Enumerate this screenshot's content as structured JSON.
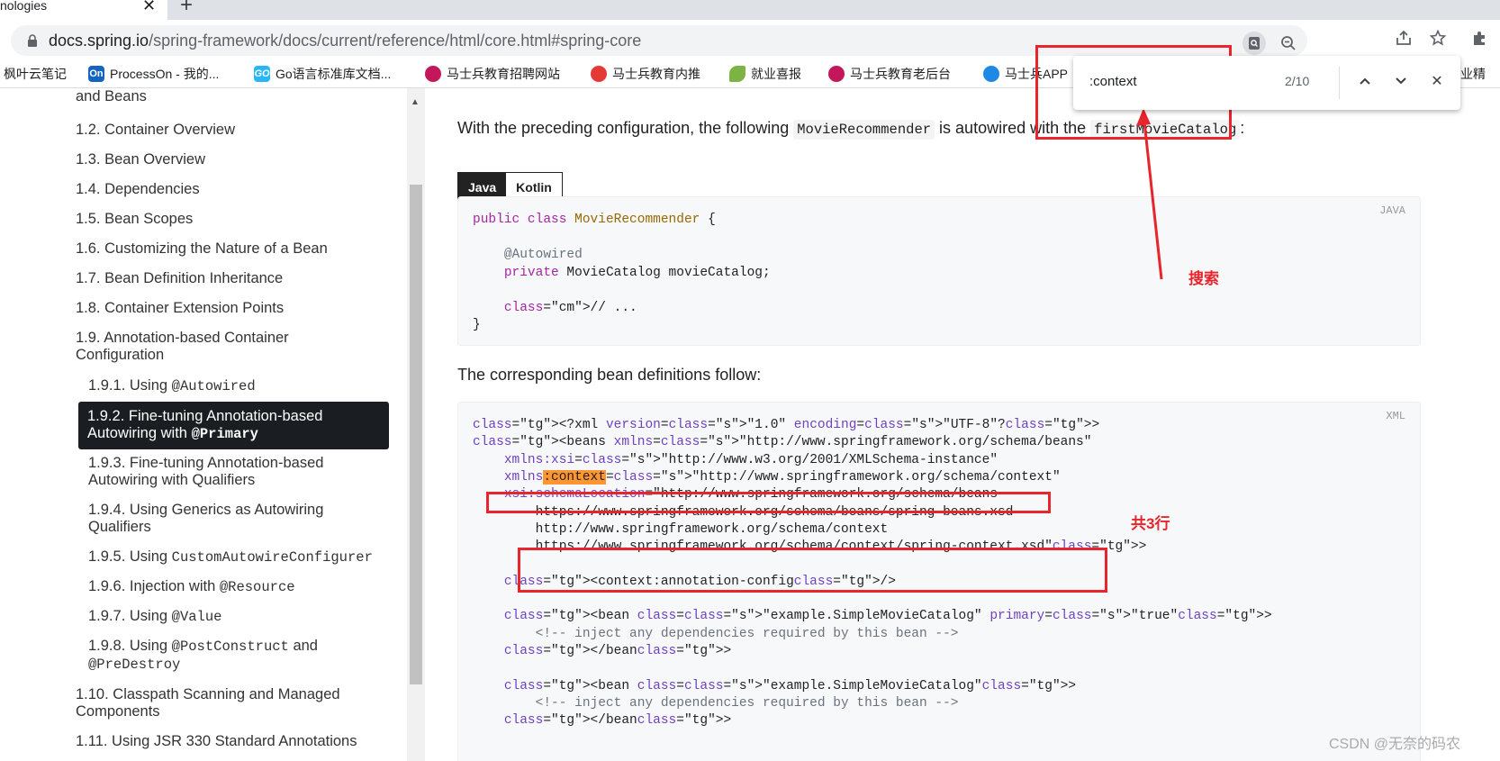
{
  "tab": {
    "title": "nologies",
    "close": "✕",
    "newtab": "+"
  },
  "address": {
    "host": "docs.spring.io",
    "path": "/spring-framework/docs/current/reference/html/core.html#spring-core"
  },
  "toolbar_icons": [
    "find-in-page-icon",
    "zoom-icon",
    "share-icon",
    "bookmark-star-icon",
    "extensions-icon"
  ],
  "bookmarks": [
    {
      "label": "枫叶云笔记",
      "icon_text": "",
      "color": "#4caf50"
    },
    {
      "label": "ProcessOn - 我的...",
      "icon_text": "On",
      "color": "#1565c0"
    },
    {
      "label": "Go语言标准库文档...",
      "icon_text": "GO",
      "color": "#29b6f6"
    },
    {
      "label": "马士兵教育招聘网站",
      "icon_text": "",
      "color": "#c2185b"
    },
    {
      "label": "马士兵教育内推",
      "icon_text": "",
      "color": "#e53935"
    },
    {
      "label": "就业喜报",
      "icon_text": "",
      "color": "#7cb342"
    },
    {
      "label": "马士兵教育老后台",
      "icon_text": "",
      "color": "#c2185b"
    },
    {
      "label": "马士兵APP",
      "icon_text": "",
      "color": "#1e88e5"
    },
    {
      "label": "专业精",
      "icon_text": "",
      "color": "#1e88e5"
    }
  ],
  "find": {
    "query": ":context",
    "count": "2/10",
    "prev": "︿",
    "next": "﹀",
    "close": "✕"
  },
  "toc": [
    {
      "label": "and Beans"
    },
    {
      "label": "1.2. Container Overview"
    },
    {
      "label": "1.3. Bean Overview"
    },
    {
      "label": "1.4. Dependencies"
    },
    {
      "label": "1.5. Bean Scopes"
    },
    {
      "label": "1.6. Customizing the Nature of a Bean"
    },
    {
      "label": "1.7. Bean Definition Inheritance"
    },
    {
      "label": "1.8. Container Extension Points"
    },
    {
      "label": "1.9. Annotation-based Container"
    },
    {
      "label": "Configuration"
    },
    {
      "label": "1.9.1. Using ",
      "code": "@Autowired"
    },
    {
      "label": "1.9.2. Fine-tuning Annotation-based",
      "label2": "Autowiring with ",
      "code": "@Primary"
    },
    {
      "label": "1.9.3. Fine-tuning Annotation-based"
    },
    {
      "label": "Autowiring with Qualifiers"
    },
    {
      "label": "1.9.4. Using Generics as Autowiring"
    },
    {
      "label": "Qualifiers"
    },
    {
      "label": "1.9.5. Using ",
      "code": "CustomAutowireConfigurer"
    },
    {
      "label": "1.9.6. Injection with ",
      "code": "@Resource"
    },
    {
      "label": "1.9.7. Using ",
      "code": "@Value"
    },
    {
      "label": "1.9.8. Using ",
      "code": "@PostConstruct",
      "tail": " and"
    },
    {
      "code": "@PreDestroy"
    },
    {
      "label": "1.10. Classpath Scanning and Managed"
    },
    {
      "label": "Components"
    },
    {
      "label": "1.11. Using JSR 330 Standard Annotations"
    }
  ],
  "main": {
    "p1_a": "With the preceding configuration, the following ",
    "p1_code1": "MovieRecommender",
    "p1_b": " is autowired with the ",
    "p1_code2": "firstMovieCatalog",
    "p1_c": ":",
    "tab_java": "Java",
    "tab_kotlin": "Kotlin",
    "code1_lang": "JAVA",
    "p2": "The corresponding bean definitions follow:",
    "code2_lang": "XML"
  },
  "code1": [
    "public class MovieRecommender {",
    "",
    "    @Autowired",
    "    private MovieCatalog movieCatalog;",
    "",
    "    // ...",
    "}"
  ],
  "code2": [
    "<?xml version=\"1.0\" encoding=\"UTF-8\"?>",
    "<beans xmlns=\"http://www.springframework.org/schema/beans\"",
    "    xmlns:xsi=\"http://www.w3.org/2001/XMLSchema-instance\"",
    "    xmlns:context=\"http://www.springframework.org/schema/context\"",
    "    xsi:schemaLocation=\"http://www.springframework.org/schema/beans",
    "        https://www.springframework.org/schema/beans/spring-beans.xsd",
    "        http://www.springframework.org/schema/context",
    "        https://www.springframework.org/schema/context/spring-context.xsd\">",
    "",
    "    <context:annotation-config/>",
    "",
    "    <bean class=\"example.SimpleMovieCatalog\" primary=\"true\">",
    "        <!-- inject any dependencies required by this bean -->",
    "    </bean>",
    "",
    "    <bean class=\"example.SimpleMovieCatalog\">",
    "        <!-- inject any dependencies required by this bean -->",
    "    </bean>"
  ],
  "annotations": {
    "search_label": "搜索",
    "lines_label": "共3行"
  },
  "watermark": "CSDN @无奈的码农",
  "colors": {
    "annotation_red": "#e8242c",
    "find_highlight": "#ff9632",
    "active_toc_bg": "#1a1e22"
  }
}
